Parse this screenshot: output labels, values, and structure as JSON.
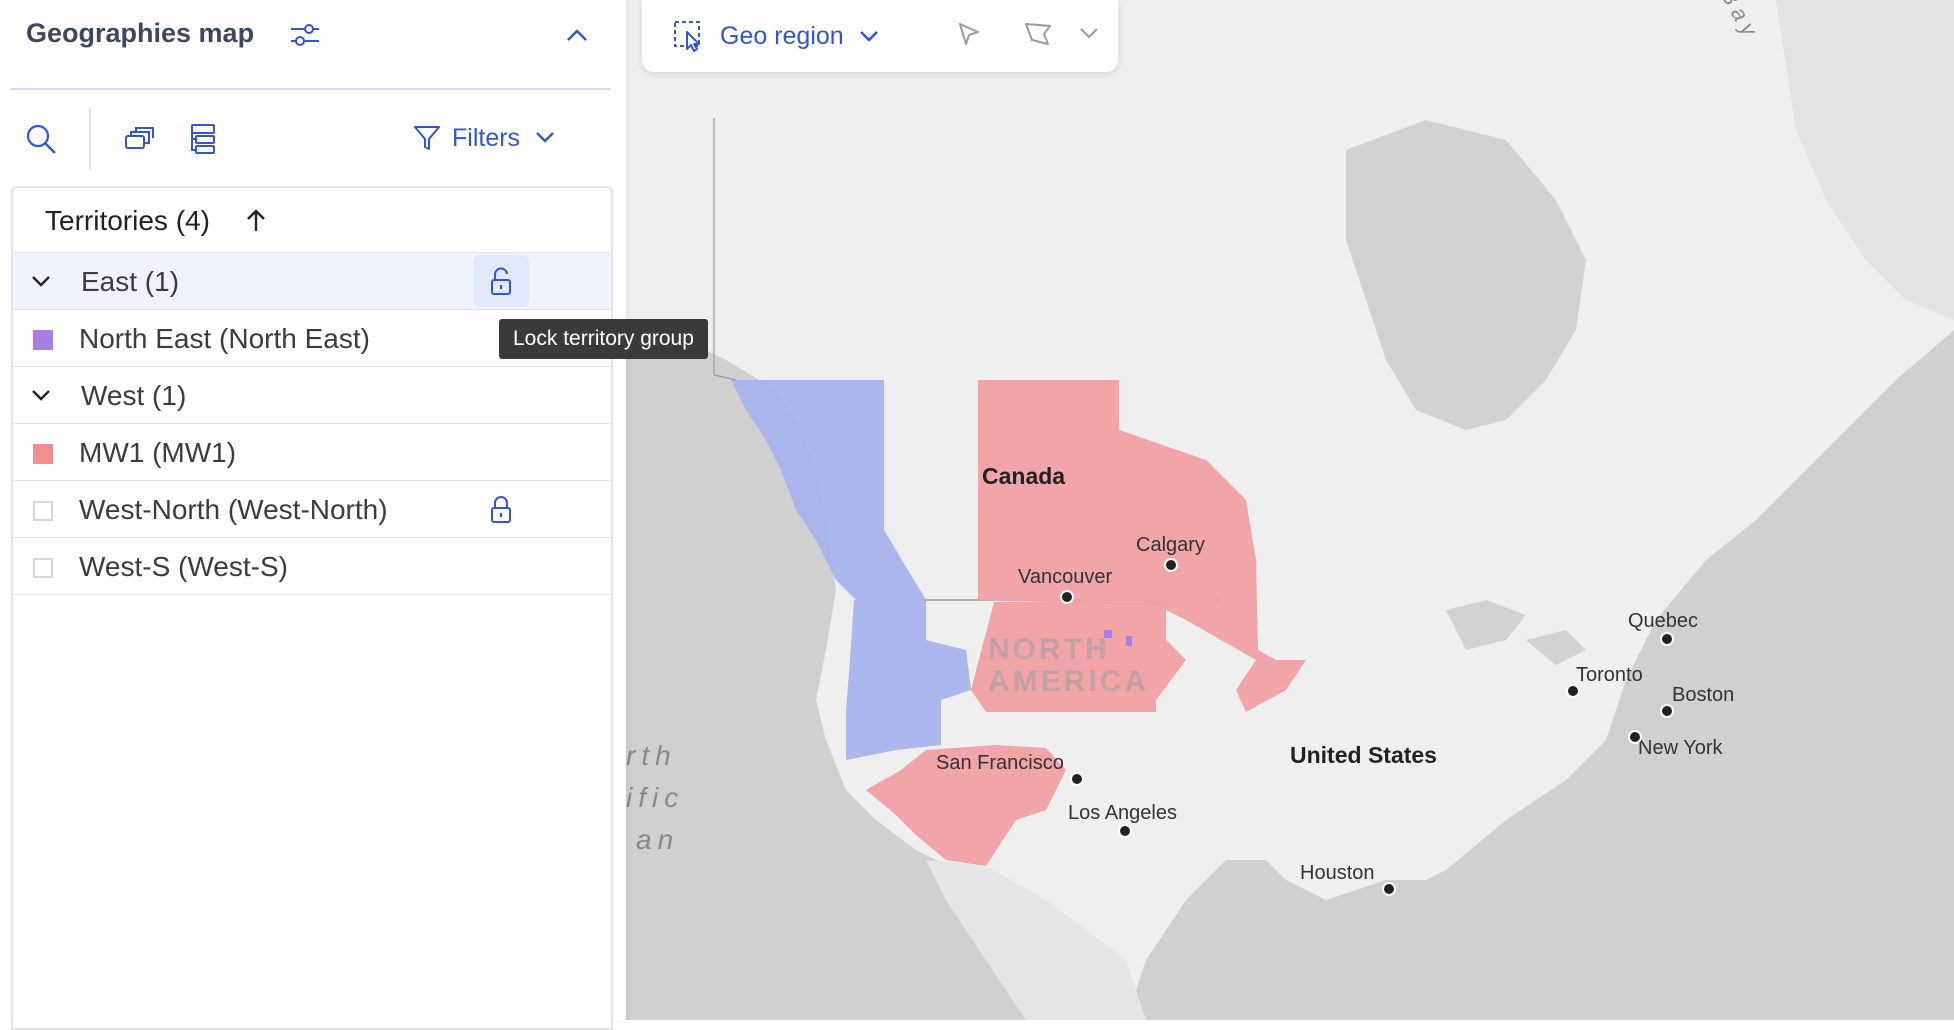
{
  "panel": {
    "title": "Geographies map",
    "toolbar": {
      "filters_label": "Filters"
    }
  },
  "list": {
    "header": "Territories (4)",
    "rows": [
      {
        "type": "group",
        "label": "East (1)"
      },
      {
        "type": "item",
        "label": "North East (North East)",
        "color": "#a77ee2"
      },
      {
        "type": "group",
        "label": "West (1)"
      },
      {
        "type": "item",
        "label": "MW1 (MW1)",
        "color": "#f08e92"
      },
      {
        "type": "item",
        "label": "West-North (West-North)"
      },
      {
        "type": "item",
        "label": "West-S (West-S)"
      }
    ],
    "tooltip": "Lock territory group"
  },
  "map_toolbar": {
    "geo_label": "Geo region"
  },
  "map": {
    "colors": {
      "blue_territory": "#a7b3ec",
      "red_territory": "#f0a0a3",
      "land": "#efefef",
      "water": "#cfcfcf"
    },
    "labels": {
      "canada": "Canada",
      "united_states": "United States",
      "north_america_line1": "NORTH",
      "north_america_line2": "AMERICA",
      "ocean_line1": "rth",
      "ocean_line2": "ific",
      "ocean_line3": "an",
      "bay": "Bay",
      "calgary": "Calgary",
      "vancouver": "Vancouver",
      "quebec": "Quebec",
      "toronto": "Toronto",
      "boston": "Boston",
      "new_york": "New York",
      "san_francisco": "San Francisco",
      "los_angeles": "Los Angeles",
      "houston": "Houston"
    }
  }
}
